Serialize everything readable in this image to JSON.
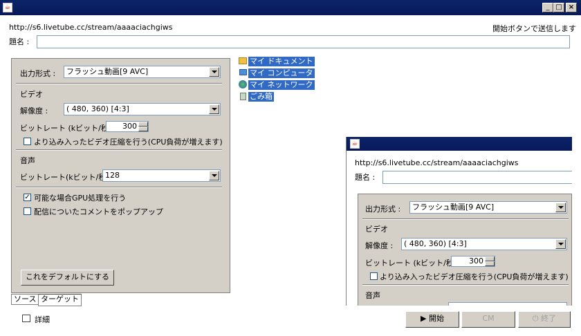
{
  "window": {
    "title": "",
    "icon": "java-icon",
    "controls": [
      "minimize",
      "maximize",
      "close"
    ]
  },
  "header": {
    "url": "http://s6.livetube.cc/stream/aaaaciachgiws",
    "hint": "開始ボタンで送信します",
    "title_label": "題名 :",
    "title_value": ""
  },
  "settings": {
    "output_format_label": "出力形式 :",
    "output_format_value": "フラッシュ動画[9 AVC]",
    "video_section": "ビデオ",
    "resolution_label": "解像度 :",
    "resolution_value": "( 480, 360) [4:3]",
    "video_bitrate_label": "ビットレート (kビット/秒) :",
    "video_bitrate_value": "300",
    "better_compression_label": "より込み入ったビデオ圧縮を行う(CPU負荷が増えます)",
    "better_compression_checked": false,
    "audio_section": "音声",
    "audio_bitrate_label": "ビットレート(kビット/秒) :",
    "audio_bitrate_value": "128",
    "gpu_label": "可能な場合GPU処理を行う",
    "gpu_checked": true,
    "popup_label": "配信についたコメントをポップアップ",
    "popup_checked": false,
    "default_button": "これをデフォルトにする"
  },
  "tabs": [
    {
      "label": "ソース",
      "active": false
    },
    {
      "label": "ターゲット",
      "active": true
    }
  ],
  "desktop_items": [
    {
      "label": "マイ ドキュメント",
      "icon": "folder-icon"
    },
    {
      "label": "マイ コンピュータ",
      "icon": "computer-icon"
    },
    {
      "label": "マイ ネットワーク",
      "icon": "network-icon"
    },
    {
      "label": "ごみ箱",
      "icon": "recycle-bin-icon"
    }
  ],
  "preview": {
    "url": "http://s6.livetube.cc/stream/aaaaciachgiws",
    "title_label": "題名 :",
    "output_format_label": "出力形式 :",
    "output_format_value": "フラッシュ動画[9 AVC]",
    "video_section": "ビデオ",
    "resolution_label": "解像度 :",
    "resolution_value": "( 480, 360) [4:3]",
    "video_bitrate_label": "ビットレート (kビット/秒) :",
    "video_bitrate_value": "300",
    "better_compression_label": "より込み入ったビデオ圧縮を行う(CPU負荷が増えます)",
    "audio_section": "音声"
  },
  "footer": {
    "details_label": "詳細",
    "start_button": "開始",
    "cm_button": "CM",
    "stop_button": "終了"
  }
}
